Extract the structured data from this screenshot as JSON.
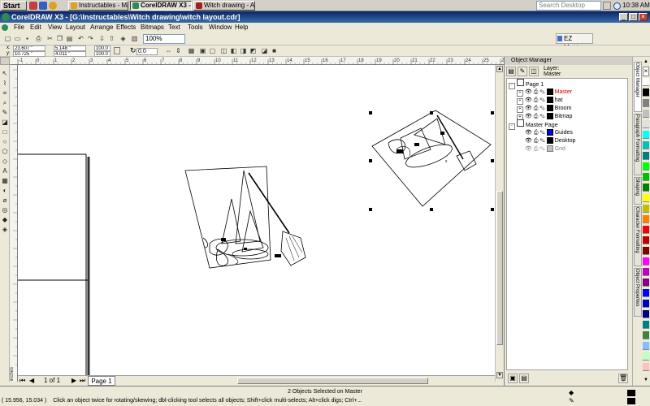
{
  "taskbar": {
    "start_label": "Start",
    "tasks": [
      {
        "label": "Instructables - Mak...",
        "active": false
      },
      {
        "label": "CorelDRAW X3 - ...",
        "active": true
      },
      {
        "label": "Witch drawing - A...",
        "active": false
      }
    ],
    "search_placeholder": "Search Desktop",
    "clock": "10:38 AM"
  },
  "window": {
    "title": "CorelDRAW X3 - [G:\\Instructables\\Witch drawing\\witch layout.cdr]"
  },
  "menu": [
    "File",
    "Edit",
    "View",
    "Layout",
    "Arrange",
    "Effects",
    "Bitmaps",
    "Text",
    "Tools",
    "Window",
    "Help"
  ],
  "toolbar": {
    "zoom": "100%",
    "ez_metrics": "EZ Metrics"
  },
  "property_bar": {
    "x": "23.607 \"",
    "y": "10.725 \"",
    "width": "5.148 \"",
    "height": "4.011 \"",
    "scale_x": "100.0",
    "scale_y": "100.0",
    "angle": "0.0"
  },
  "ruler": {
    "units": "inches",
    "h_labels": [
      "-1",
      "0",
      "1",
      "2",
      "3",
      "4",
      "5",
      "6",
      "7",
      "8",
      "9",
      "10",
      "11",
      "12",
      "13",
      "14",
      "15",
      "16",
      "17",
      "18",
      "19",
      "20",
      "21",
      "22",
      "23",
      "24",
      "25",
      "26"
    ]
  },
  "page_nav": {
    "page_count": "1 of 1",
    "page_tab": "Page 1"
  },
  "docker": {
    "title": "Object Manager",
    "layer_label": "Layer:",
    "layer_name": "Master",
    "tree": [
      {
        "label": "Page 1",
        "level": 0,
        "color": ""
      },
      {
        "label": "Master",
        "level": 1,
        "color": "#000000",
        "highlight": true
      },
      {
        "label": "hat",
        "level": 1,
        "color": "#000000"
      },
      {
        "label": "Broom",
        "level": 1,
        "color": "#000000"
      },
      {
        "label": "Bitmap",
        "level": 1,
        "color": "#000000"
      },
      {
        "label": "Master Page",
        "level": 0,
        "color": ""
      },
      {
        "label": "Guides",
        "level": 1,
        "color": "#0000ff"
      },
      {
        "label": "Desktop",
        "level": 1,
        "color": "#000000"
      },
      {
        "label": "Grid",
        "level": 1,
        "color": "#c0c0c0"
      }
    ],
    "tabs": [
      "Object Manager",
      "Paragraph Formatting",
      "Shaping",
      "Character Formatting",
      "Object Properties"
    ]
  },
  "palette": [
    "#ffffff",
    "#000000",
    "#808080",
    "#c0c0c0",
    "#e0e0e0",
    "#00ffff",
    "#00c0c0",
    "#008080",
    "#00ff00",
    "#00c000",
    "#008000",
    "#ffff00",
    "#c0c000",
    "#ff8000",
    "#ff0000",
    "#c00000",
    "#800000",
    "#ff00ff",
    "#c000c0",
    "#800080",
    "#0000ff",
    "#0000c0",
    "#000080",
    "#008080",
    "#408040",
    "#80c0ff",
    "#c0ffc0",
    "#ffc0c0"
  ],
  "status": {
    "selection": "2 Objects Selected on Master",
    "coords": "( 15.956, 15.034 )",
    "hint": "Click an object twice for rotating/skewing; dbl-clicking tool selects all objects; Shift+click multi-selects; Alt+click digs; Ctrl+..."
  }
}
